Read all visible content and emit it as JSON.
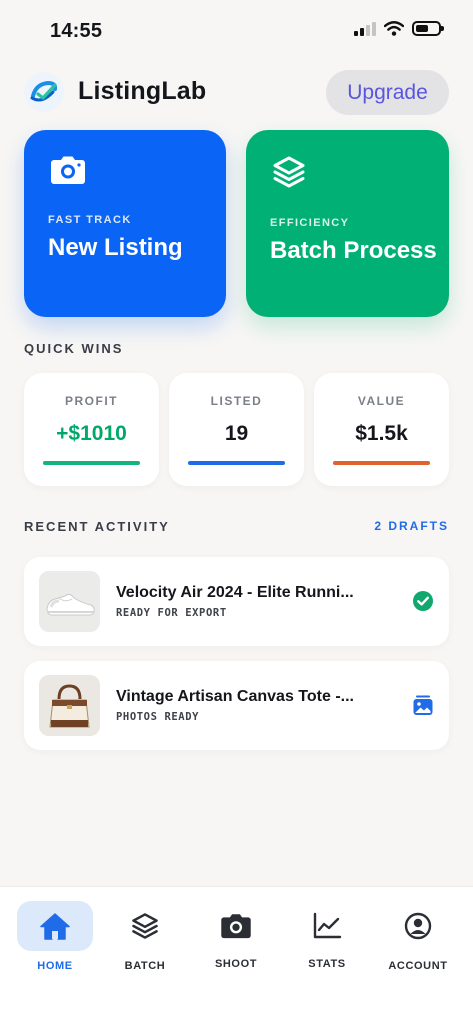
{
  "status_bar": {
    "time": "14:55"
  },
  "header": {
    "app_name": "ListingLab",
    "upgrade_label": "Upgrade"
  },
  "actions": {
    "fast_track": {
      "kicker": "FAST TRACK",
      "title": "New Listing",
      "icon": "camera-icon",
      "color": "#0a64f5"
    },
    "efficiency": {
      "kicker": "EFFICIENCY",
      "title": "Batch Process",
      "icon": "layers-icon",
      "color": "#00b074"
    }
  },
  "quick_wins": {
    "title": "QUICK WINS",
    "stats": [
      {
        "label": "PROFIT",
        "value": "+$1010",
        "value_color": "#00a86b",
        "bar_color": "#14b47a"
      },
      {
        "label": "LISTED",
        "value": "19",
        "value_color": "#111318",
        "bar_color": "#1f6be8"
      },
      {
        "label": "VALUE",
        "value": "$1.5k",
        "value_color": "#111318",
        "bar_color": "#e0622e"
      }
    ]
  },
  "recent_activity": {
    "title": "RECENT ACTIVITY",
    "drafts_label": "2 DRAFTS",
    "items": [
      {
        "title": "Velocity Air 2024 - Elite Runni...",
        "status": "READY FOR EXPORT",
        "thumb": "sneaker",
        "status_icon": "check-circle-icon"
      },
      {
        "title": "Vintage Artisan Canvas Tote -...",
        "status": "PHOTOS READY",
        "thumb": "tote-bag",
        "status_icon": "photos-icon"
      }
    ]
  },
  "tabbar": {
    "tabs": [
      {
        "label": "HOME",
        "icon": "home-icon",
        "active": true
      },
      {
        "label": "BATCH",
        "icon": "layers-icon"
      },
      {
        "label": "SHOOT",
        "icon": "camera-icon"
      },
      {
        "label": "STATS",
        "icon": "chart-icon"
      },
      {
        "label": "ACCOUNT",
        "icon": "account-icon"
      }
    ]
  },
  "colors": {
    "accent_blue": "#1f6be8",
    "success_green": "#00b074",
    "warm_orange": "#e0622e",
    "background": "#f7f6f4"
  }
}
